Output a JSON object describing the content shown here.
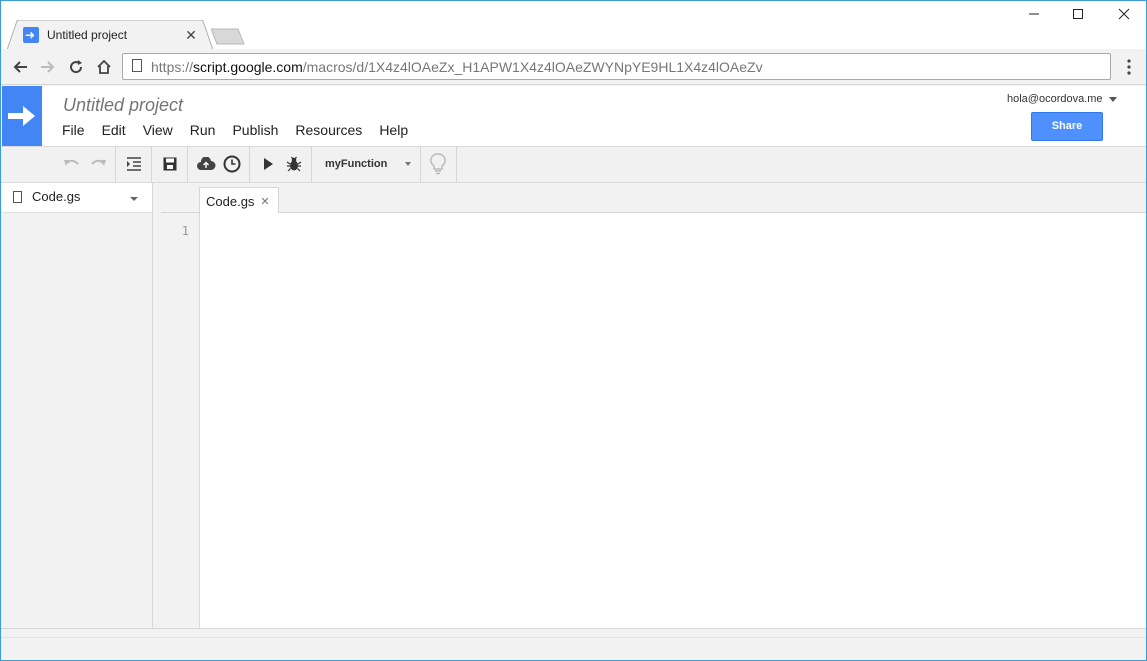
{
  "browser": {
    "tab_title": "Untitled project",
    "url_prefix": "https://",
    "url_host": "script.google.com",
    "url_path": "/macros/d/1X4z4lOAeZx_H1APW1X4z4lOAeZWYNpYE9HL1X4z4lOAeZv"
  },
  "app": {
    "project_title": "Untitled project",
    "menus": [
      "File",
      "Edit",
      "View",
      "Run",
      "Publish",
      "Resources",
      "Help"
    ],
    "account": "hola@ocordova.me",
    "share_label": "Share",
    "accent_color": "#4285f4"
  },
  "toolbar": {
    "function_select": "myFunction"
  },
  "sidebar": {
    "files": [
      {
        "name": "Code.gs"
      }
    ]
  },
  "editor": {
    "tab_label": "Code.gs",
    "line_numbers": [
      "1"
    ]
  }
}
